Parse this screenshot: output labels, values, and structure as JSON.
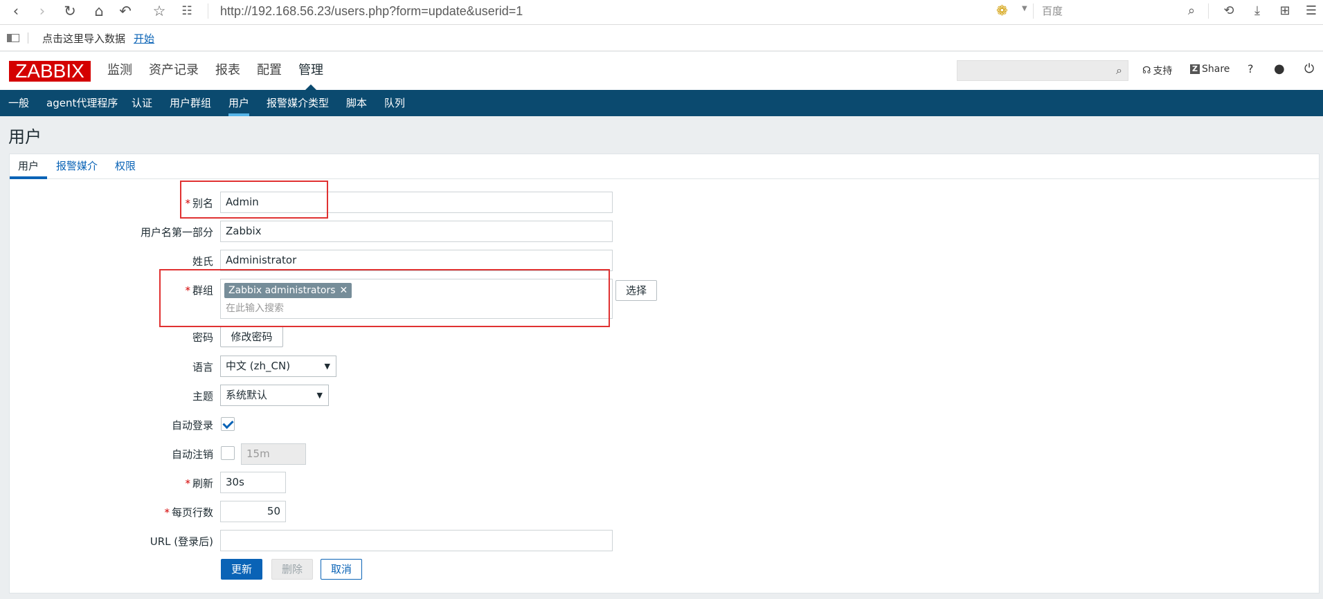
{
  "browser": {
    "url": "http://192.168.56.23/users.php?form=update&userid=1",
    "search_engine": "百度",
    "bookmarks_text": "点击这里导入数据",
    "bookmarks_link": "开始"
  },
  "header": {
    "logo": "ZABBIX",
    "main_menu": [
      "监测",
      "资产记录",
      "报表",
      "配置",
      "管理"
    ],
    "support": "支持",
    "share": "Share",
    "share_badge": "Z",
    "help": "?"
  },
  "sub_menu": [
    "一般",
    "agent代理程序",
    "认证",
    "用户群组",
    "用户",
    "报警媒介类型",
    "脚本",
    "队列"
  ],
  "page": {
    "title": "用户",
    "tabs": [
      "用户",
      "报警媒介",
      "权限"
    ]
  },
  "form": {
    "alias_label": "别名",
    "alias_value": "Admin",
    "name_label": "用户名第一部分",
    "name_value": "Zabbix",
    "surname_label": "姓氏",
    "surname_value": "Administrator",
    "groups_label": "群组",
    "group_chip": "Zabbix administrators",
    "groups_placeholder": "在此输入搜索",
    "select_button": "选择",
    "password_label": "密码",
    "change_password_button": "修改密码",
    "language_label": "语言",
    "language_value": "中文 (zh_CN)",
    "theme_label": "主题",
    "theme_value": "系统默认",
    "autologin_label": "自动登录",
    "autologin_checked": true,
    "autologout_label": "自动注销",
    "autologout_checked": false,
    "autologout_value": "15m",
    "refresh_label": "刷新",
    "refresh_value": "30s",
    "rows_label": "每页行数",
    "rows_value": "50",
    "url_label": "URL (登录后)",
    "url_value": "",
    "update_button": "更新",
    "delete_button": "删除",
    "cancel_button": "取消"
  },
  "colors": {
    "brand_red": "#d40000",
    "nav_blue": "#0b4a6f",
    "primary_blue": "#0a63b6",
    "annotation_red": "#e03131"
  }
}
